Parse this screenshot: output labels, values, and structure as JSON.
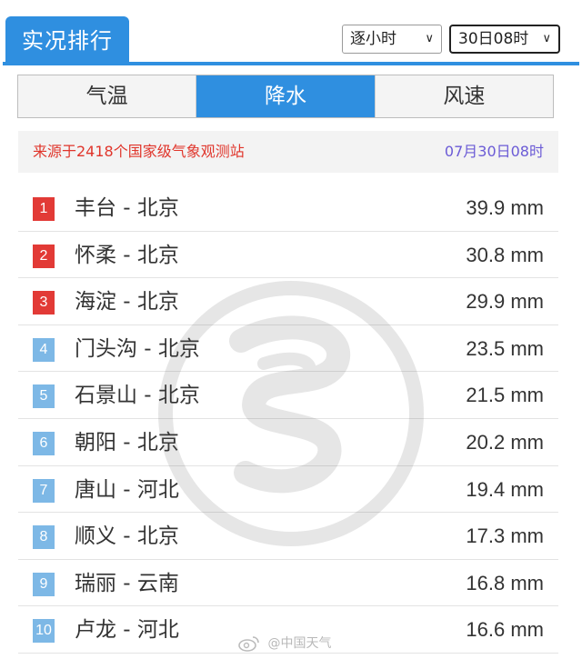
{
  "header": {
    "title": "实况排行"
  },
  "filters": {
    "interval": {
      "selected": "逐小时"
    },
    "time": {
      "selected": "30日08时"
    }
  },
  "tabs": [
    {
      "label": "气温",
      "active": false
    },
    {
      "label": "降水",
      "active": true
    },
    {
      "label": "风速",
      "active": false
    }
  ],
  "info": {
    "source": "来源于2418个国家级气象观测站",
    "updated": "07月30日08时"
  },
  "ranking": [
    {
      "rank": "1",
      "name": "丰台 - 北京",
      "value": "39.9 mm"
    },
    {
      "rank": "2",
      "name": "怀柔 - 北京",
      "value": "30.8 mm"
    },
    {
      "rank": "3",
      "name": "海淀 - 北京",
      "value": "29.9 mm"
    },
    {
      "rank": "4",
      "name": "门头沟 - 北京",
      "value": "23.5 mm"
    },
    {
      "rank": "5",
      "name": "石景山 - 北京",
      "value": "21.5 mm"
    },
    {
      "rank": "6",
      "name": "朝阳 - 北京",
      "value": "20.2 mm"
    },
    {
      "rank": "7",
      "name": "唐山 - 河北",
      "value": "19.4 mm"
    },
    {
      "rank": "8",
      "name": "顺义 - 北京",
      "value": "17.3 mm"
    },
    {
      "rank": "9",
      "name": "瑞丽 - 云南",
      "value": "16.8 mm"
    },
    {
      "rank": "10",
      "name": "卢龙 - 河北",
      "value": "16.6 mm"
    }
  ],
  "overlay": {
    "credit": "@中国天气"
  },
  "colors": {
    "accent": "#2f8fe0",
    "top_rank": "#e23a36",
    "other_rank": "#7db8e6",
    "source_text": "#e0352b",
    "time_text": "#6b5bd6"
  }
}
